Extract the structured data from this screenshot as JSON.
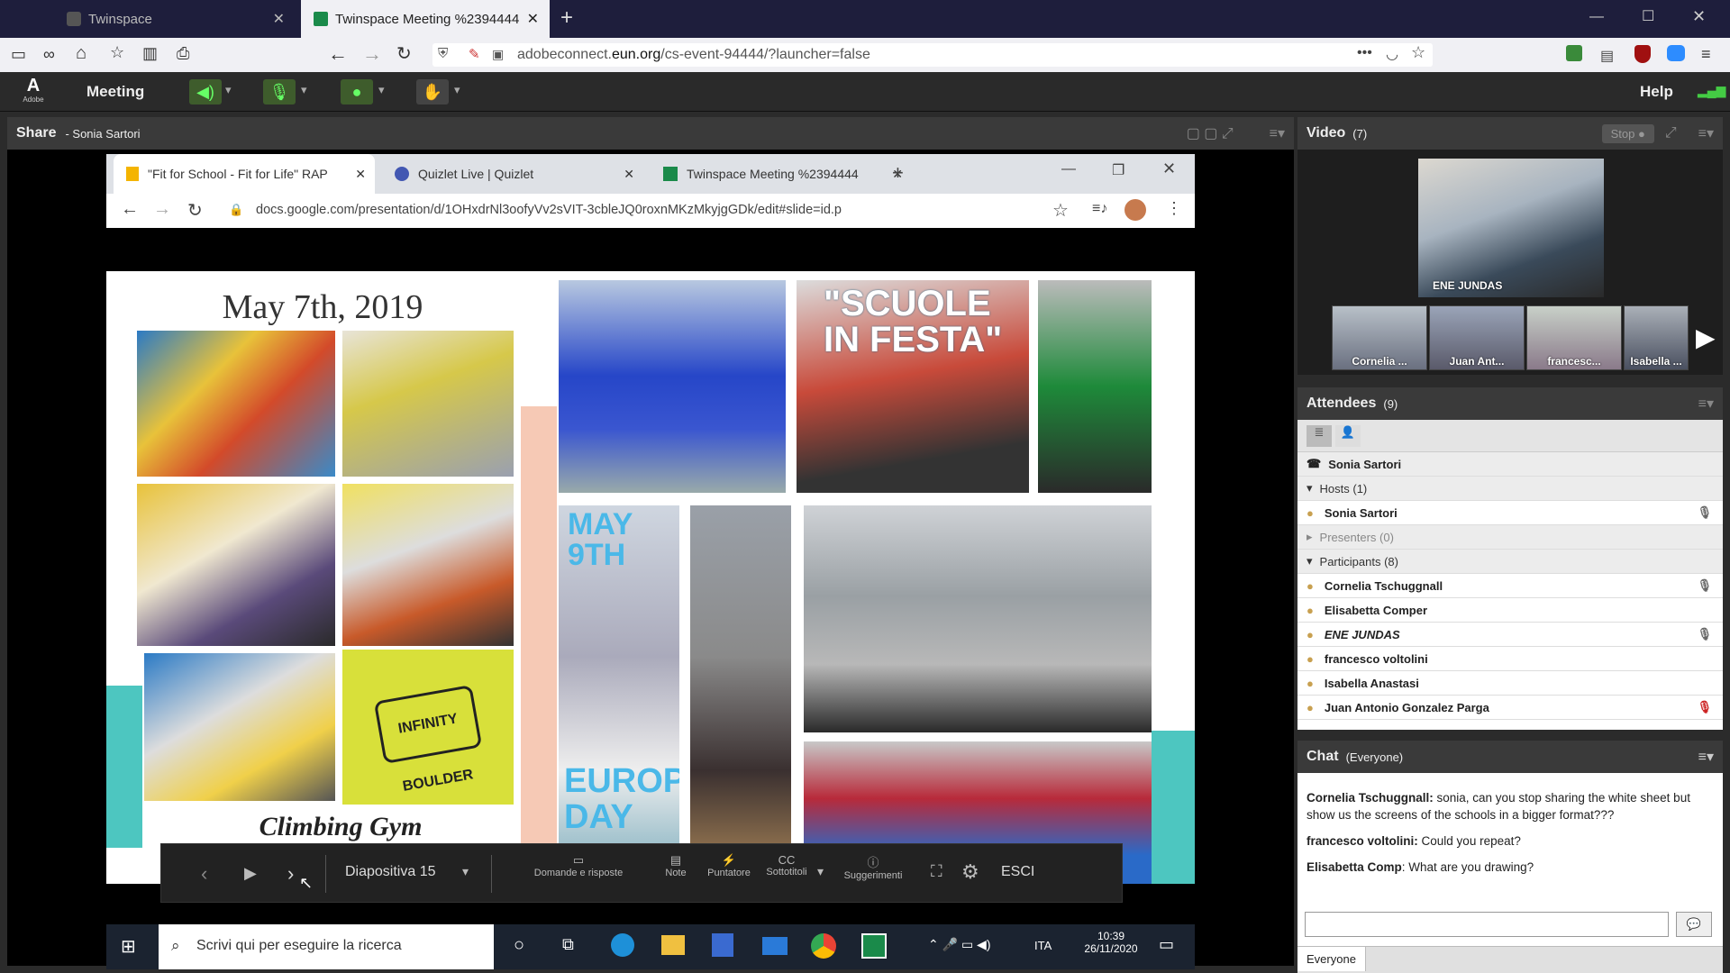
{
  "firefox": {
    "tab1_title": "Twinspace",
    "tab2_title": "Twinspace Meeting %2394444",
    "url_prefix": "adobeconnect.",
    "url_domain": "eun.org",
    "url_path": "/cs-event-94444/?launcher=false"
  },
  "connect": {
    "meeting_menu": "Meeting",
    "help": "Help",
    "adobe_label": "Adobe",
    "share_title": "Share",
    "share_presenter": "- Sonia Sartori"
  },
  "chrome": {
    "tab1": "\"Fit for School - Fit for Life\" RAP",
    "tab2": "Quizlet Live | Quizlet",
    "tab3": "Twinspace Meeting %2394444",
    "url": "docs.google.com/presentation/d/1OHxdrNl3oofyVv2sVIT-3cbleJQ0roxnMKzMkyjgGDk/edit#slide=id.p"
  },
  "slide": {
    "date": "May 7th, 2019",
    "scuole": "\"SCUOLE IN FESTA\"",
    "may9": "MAY 9TH",
    "europe": "EUROPE DAY",
    "climbing": "Climbing Gym",
    "infinity": "INFINITY BOULDER"
  },
  "slide_controls": {
    "slide_label": "Diapositiva 15",
    "qa": "Domande e risposte",
    "notes": "Note",
    "pointer": "Puntatore",
    "subtitles": "Sottotitoli",
    "suggestions": "Suggerimenti",
    "exit": "ESCI"
  },
  "taskbar": {
    "search": "Scrivi qui per eseguire la ricerca",
    "lang": "ITA",
    "time": "10:39",
    "date": "26/11/2020"
  },
  "video": {
    "title": "Video",
    "count": "(7)",
    "stop": "Stop",
    "main_name": "ENE JUNDAS",
    "thumbs": [
      "Cornelia ...",
      "Juan Ant...",
      "francesc...",
      "Isabella ..."
    ]
  },
  "attendees": {
    "title": "Attendees",
    "count": "(9)",
    "me": "Sonia Sartori",
    "hosts_label": "Hosts (1)",
    "hosts": [
      "Sonia Sartori"
    ],
    "presenters_label": "Presenters (0)",
    "participants_label": "Participants (8)",
    "participants": [
      "Cornelia Tschuggnall",
      "Elisabetta Comper",
      "ENE JUNDAS",
      "francesco voltolini",
      "Isabella Anastasi",
      "Juan Antonio Gonzalez Parga"
    ]
  },
  "chat": {
    "title": "Chat",
    "scope": "(Everyone)",
    "messages": [
      {
        "from": "Cornelia Tschuggnall:",
        "text": " sonia, can you stop sharing the white sheet but show us the screens of the schools in a bigger format???"
      },
      {
        "from": "francesco voltolini:",
        "text": " Could you repeat?"
      },
      {
        "from": "Elisabetta Comp",
        "text": ": What are you drawing?"
      }
    ],
    "recipient": "Everyone"
  }
}
